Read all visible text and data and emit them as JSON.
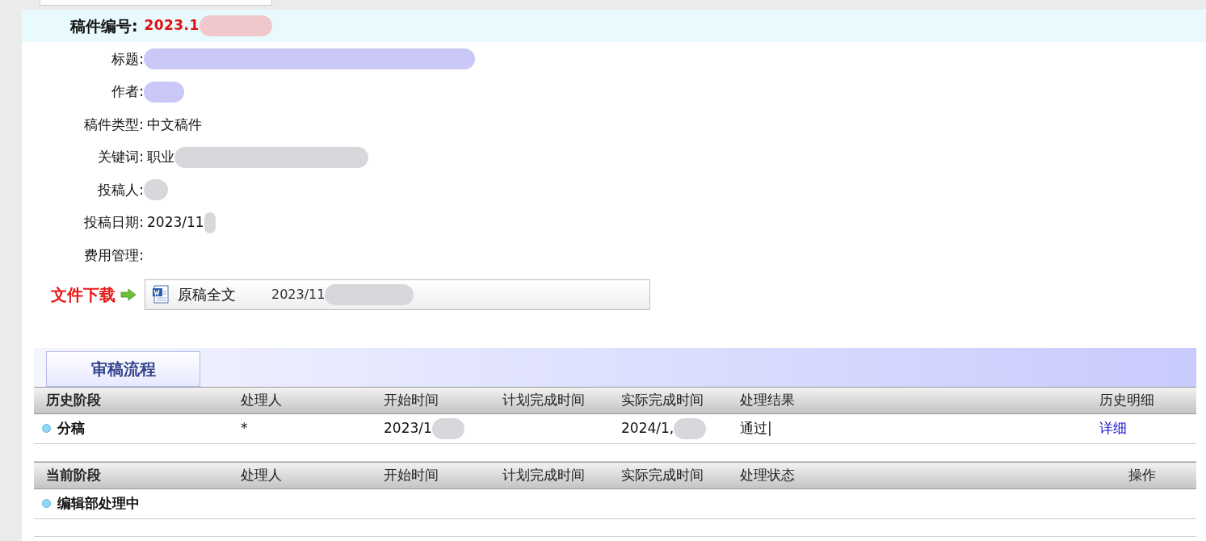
{
  "manuscript": {
    "label": "稿件编号:",
    "value": "2023.1"
  },
  "fields": [
    {
      "label": "标题:",
      "kind": "link"
    },
    {
      "label": "作者:",
      "kind": "link"
    },
    {
      "label": "稿件类型:",
      "value": "中文稿件",
      "kind": "text"
    },
    {
      "label": "关键词:",
      "value": "职业",
      "kind": "text"
    },
    {
      "label": "投稿人:",
      "kind": "text"
    },
    {
      "label": "投稿日期:",
      "value": "2023/11",
      "kind": "text"
    },
    {
      "label": "费用管理:"
    }
  ],
  "download": {
    "label": "文件下载",
    "file": "原稿全文",
    "date": "2023/11"
  },
  "section_tab": {
    "label": "审稿流程",
    "selected": true
  },
  "history": {
    "columns": [
      "历史阶段",
      "处理人",
      "开始时间",
      "计划完成时间",
      "实际完成时间",
      "处理结果",
      "历史明细"
    ],
    "rows": [
      {
        "stage": "分稿",
        "handler": "*",
        "start": "2023/1",
        "actual": "2024/1,",
        "result": "通过|",
        "detail": "详细"
      }
    ]
  },
  "current": {
    "columns": [
      "当前阶段",
      "处理人",
      "开始时间",
      "计划完成时间",
      "实际完成时间",
      "处理状态",
      "操作"
    ],
    "rows": [
      {
        "stage": "编辑部处理中"
      }
    ]
  }
}
